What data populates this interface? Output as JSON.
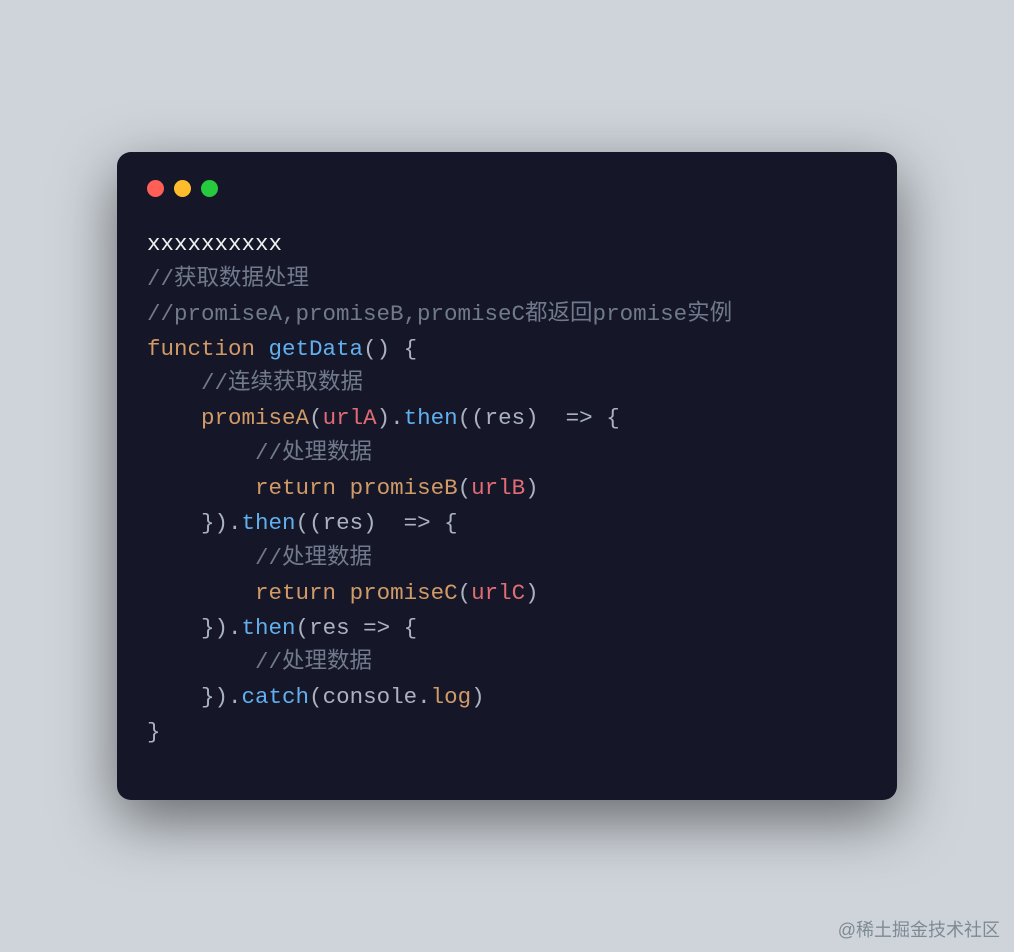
{
  "window": {
    "traffic_lights": {
      "red": "#ff5f56",
      "yellow": "#ffbd2e",
      "green": "#27c93f"
    }
  },
  "code": {
    "line1": "xxxxxxxxxx",
    "line2": "//获取数据处理",
    "line3": "//promiseA,promiseB,promiseC都返回promise实例",
    "kw_function": "function",
    "fn_getData": "getData",
    "open_paren": "(",
    "close_paren": ")",
    "space": " ",
    "open_brace": "{",
    "close_brace": "}",
    "indent1": "    ",
    "indent2": "        ",
    "cmt_continuous": "//连续获取数据",
    "call_promiseA": "promiseA",
    "id_urlA": "urlA",
    "dot": ".",
    "then": "then",
    "double_open": "((",
    "res": "res",
    "arrow": " => ",
    "close_paren_space": ") ",
    "cmt_process": "//处理数据",
    "kw_return": "return",
    "call_promiseB": "promiseB",
    "id_urlB": "urlB",
    "chain_close_then_open": "}).",
    "call_promiseC": "promiseC",
    "id_urlC": "urlC",
    "catch": "catch",
    "console": "console",
    "log": "log"
  },
  "watermark": "@稀土掘金技术社区"
}
